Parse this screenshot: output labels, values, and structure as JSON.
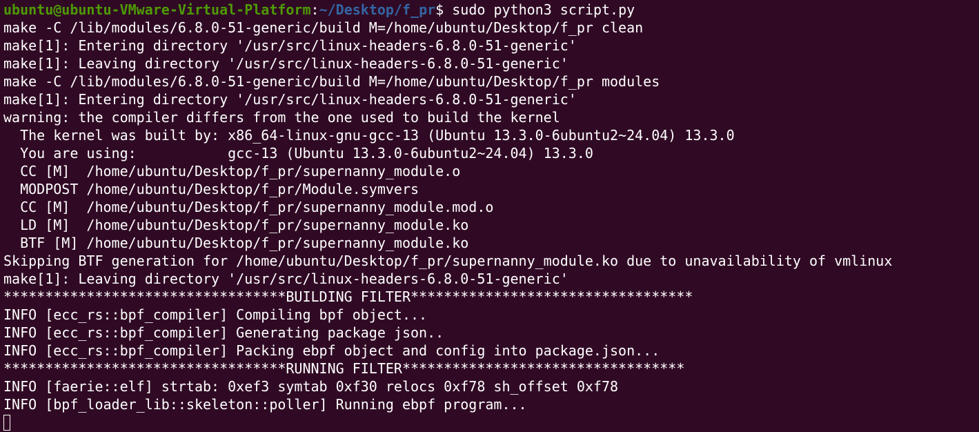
{
  "terminal": {
    "prompt": {
      "user_host": "ubuntu@ubuntu-VMware-Virtual-Platform",
      "separator": ":",
      "path": "~/Desktop/f_pr",
      "symbol": "$ ",
      "command": "sudo python3 script.py"
    },
    "output_lines": [
      "make -C /lib/modules/6.8.0-51-generic/build M=/home/ubuntu/Desktop/f_pr clean",
      "make[1]: Entering directory '/usr/src/linux-headers-6.8.0-51-generic'",
      "make[1]: Leaving directory '/usr/src/linux-headers-6.8.0-51-generic'",
      "make -C /lib/modules/6.8.0-51-generic/build M=/home/ubuntu/Desktop/f_pr modules",
      "make[1]: Entering directory '/usr/src/linux-headers-6.8.0-51-generic'",
      "warning: the compiler differs from the one used to build the kernel",
      "  The kernel was built by: x86_64-linux-gnu-gcc-13 (Ubuntu 13.3.0-6ubuntu2~24.04) 13.3.0",
      "  You are using:           gcc-13 (Ubuntu 13.3.0-6ubuntu2~24.04) 13.3.0",
      "  CC [M]  /home/ubuntu/Desktop/f_pr/supernanny_module.o",
      "  MODPOST /home/ubuntu/Desktop/f_pr/Module.symvers",
      "  CC [M]  /home/ubuntu/Desktop/f_pr/supernanny_module.mod.o",
      "  LD [M]  /home/ubuntu/Desktop/f_pr/supernanny_module.ko",
      "  BTF [M] /home/ubuntu/Desktop/f_pr/supernanny_module.ko",
      "Skipping BTF generation for /home/ubuntu/Desktop/f_pr/supernanny_module.ko due to unavailability of vmlinux",
      "make[1]: Leaving directory '/usr/src/linux-headers-6.8.0-51-generic'",
      "**********************************BUILDING FILTER**********************************",
      "INFO [ecc_rs::bpf_compiler] Compiling bpf object...",
      "INFO [ecc_rs::bpf_compiler] Generating package json..",
      "INFO [ecc_rs::bpf_compiler] Packing ebpf object and config into package.json...",
      "**********************************RUNNING FILTER**********************************",
      "INFO [faerie::elf] strtab: 0xef3 symtab 0xf30 relocs 0xf78 sh_offset 0xf78",
      "INFO [bpf_loader_lib::skeleton::poller] Running ebpf program..."
    ],
    "colors": {
      "background": "#300a24",
      "text": "#ffffff",
      "prompt_user": "#4e9a06",
      "prompt_path": "#3465a4"
    }
  }
}
